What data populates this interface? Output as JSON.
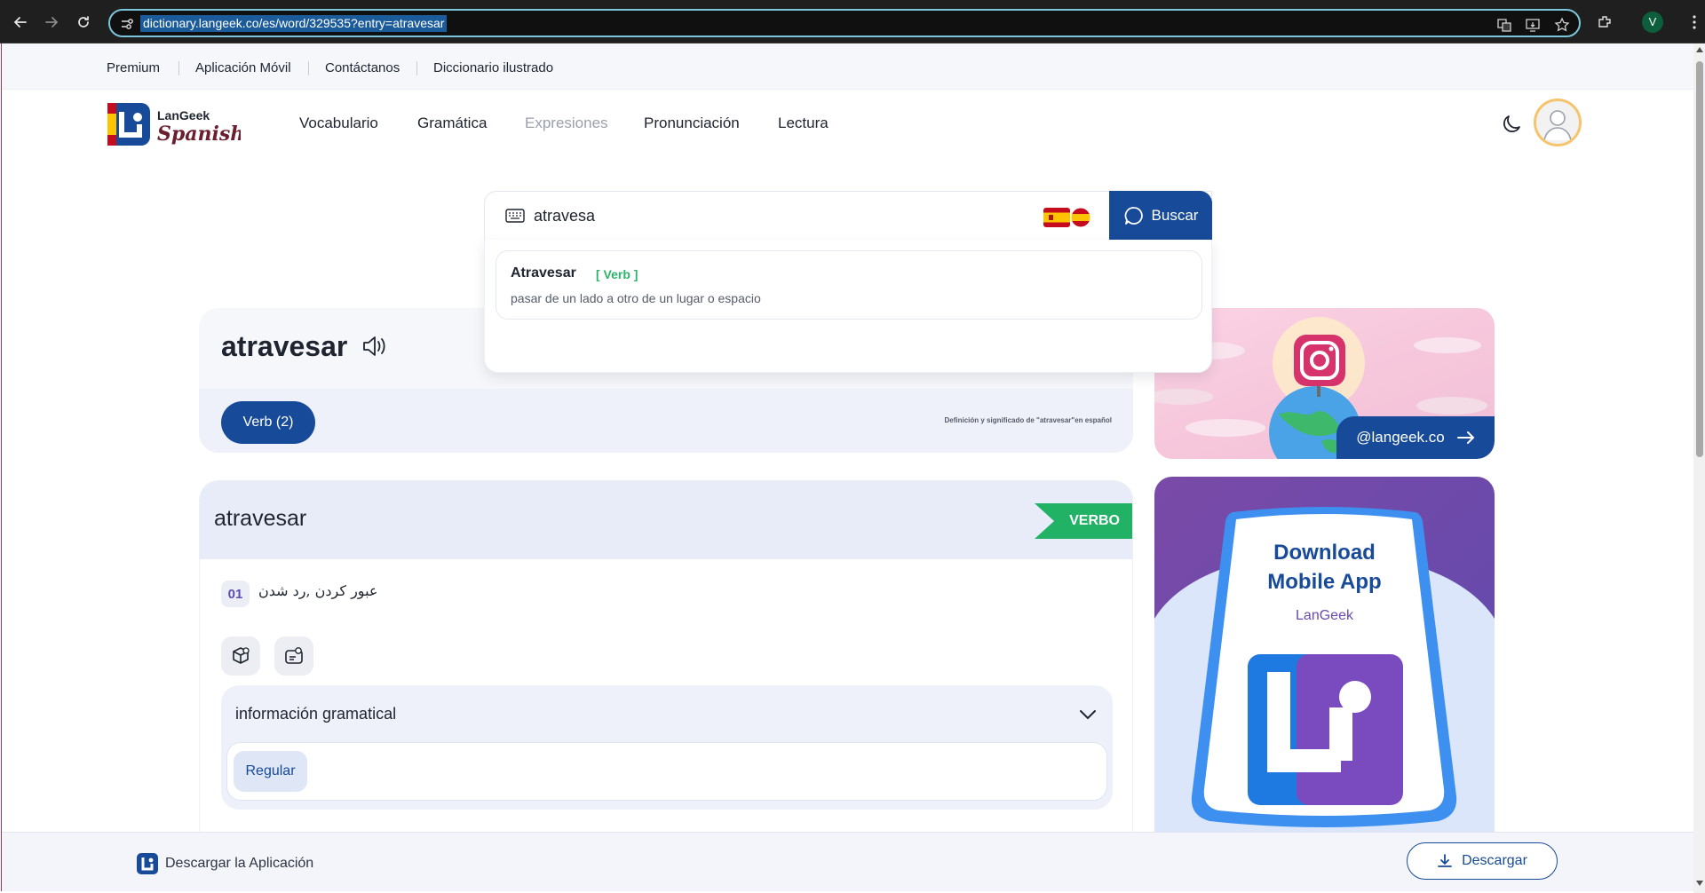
{
  "browser": {
    "url": "dictionary.langeek.co/es/word/329535?entry=atravesar",
    "profile_initial": "V"
  },
  "toplinks": [
    "Premium",
    "Aplicación Móvil",
    "Contáctanos",
    "Diccionario ilustrado"
  ],
  "logo": {
    "brand": "LanGeek",
    "language": "Spanish"
  },
  "mainnav": [
    "Vocabulario",
    "Gramática",
    "Expresiones",
    "Pronunciación",
    "Lectura"
  ],
  "search": {
    "value": "atravesa",
    "button_label": "Buscar",
    "suggestion": {
      "word": "Atravesar",
      "pos": "[ Verb ]",
      "definition": "pasar de un lado a otro de un lugar o espacio"
    }
  },
  "word_card": {
    "title": "atravesar",
    "tab_label": "Verb (2)",
    "caption": "Definición y significado de \"atravesar\"en español"
  },
  "definition": {
    "word": "atravesar",
    "pos_tag": "VERBO",
    "number": "01",
    "translation": "عبور کردن ,رد شدن",
    "grammar_title": "información gramatical",
    "grammar_chip": "Regular"
  },
  "banners": {
    "instagram_handle": "@langeek.co",
    "app_title_line1": "Download",
    "app_title_line2": "Mobile App",
    "app_brand": "LanGeek"
  },
  "bottom_bar": {
    "text": "Descargar la Aplicación",
    "button_label": "Descargar"
  },
  "colors": {
    "brand_blue": "#174a98",
    "verb_green": "#21b266",
    "brand_purple": "#6a4ab0"
  }
}
